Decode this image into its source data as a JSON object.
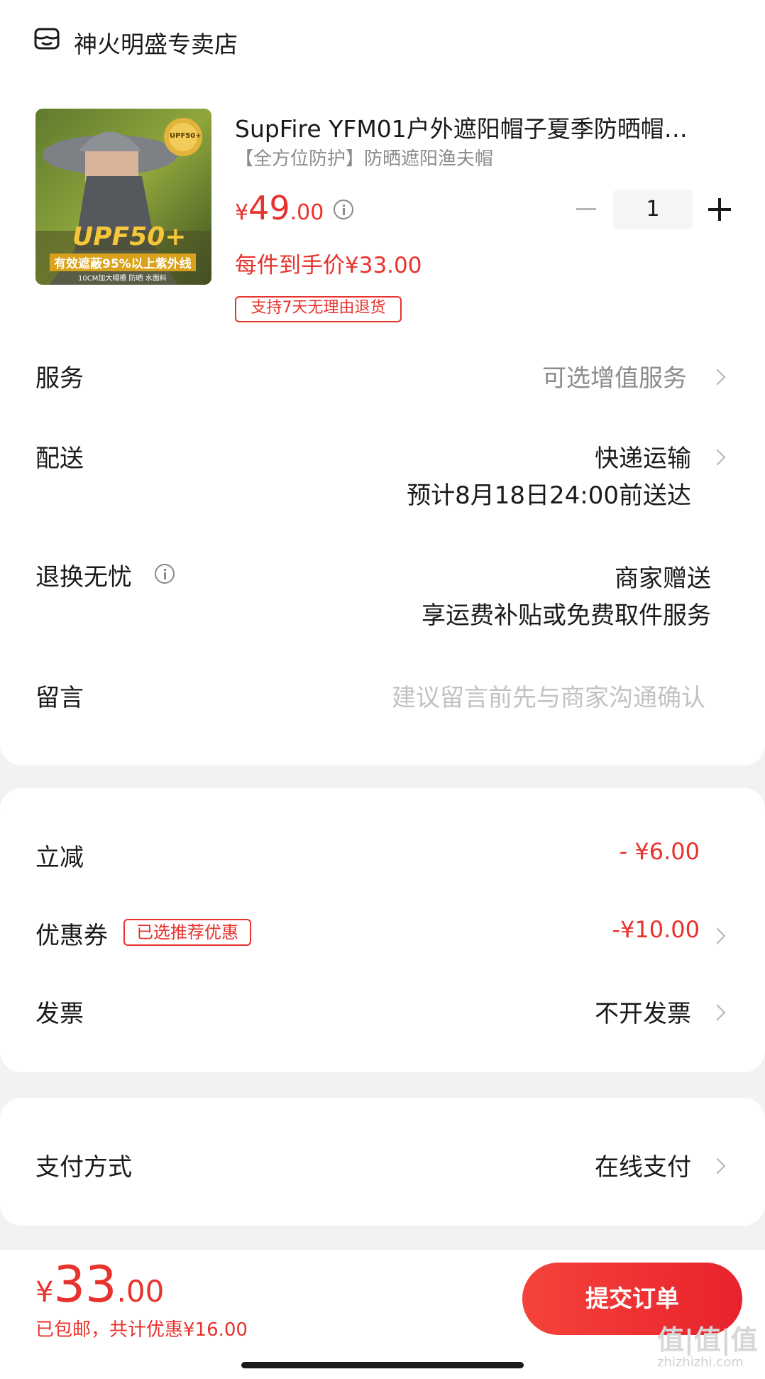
{
  "store": {
    "name": "神火明盛专卖店",
    "icon": "store-icon"
  },
  "product": {
    "title": "SupFire YFM01户外遮阳帽子夏季防晒帽…",
    "subtitle": "【全方位防护】防晒遮阳渔夫帽",
    "price_symbol": "¥",
    "price_int": "49",
    "price_dec": ".00",
    "final_price": "每件到手价¥33.00",
    "return_tag": "支持7天无理由退货",
    "quantity": "1",
    "image_badge": "UPF50+",
    "image_text": "UPF50+",
    "image_banner": "有效遮蔽95%以上紫外线",
    "image_caption": "10CM加大帽檐 防晒 水面料"
  },
  "rows": {
    "service": {
      "label": "服务",
      "value": "可选增值服务"
    },
    "delivery": {
      "label": "配送",
      "value": "快递运输",
      "sub": "预计8月18日24:00前送达"
    },
    "return": {
      "label": "退换无忧",
      "value": "商家赠送",
      "sub": "享运费补贴或免费取件服务"
    },
    "message": {
      "label": "留言",
      "placeholder": "建议留言前先与商家沟通确认"
    }
  },
  "discounts": {
    "instant": {
      "label": "立减",
      "value": "- ¥6.00"
    },
    "coupon": {
      "label": "优惠券",
      "tag": "已选推荐优惠",
      "value": "-¥10.00"
    },
    "invoice": {
      "label": "发票",
      "value": "不开发票"
    }
  },
  "payment": {
    "label": "支付方式",
    "value": "在线支付"
  },
  "footer": {
    "total_symbol": "¥",
    "total_int": "33",
    "total_dec": ".00",
    "summary": "已包邮，共计优惠¥16.00",
    "submit_label": "提交订单",
    "watermark": "值|值|值",
    "watermark_url": "zhizhizhi.com"
  },
  "colors": {
    "accent": "#e8322d",
    "button_start": "#f5433b",
    "button_end": "#e8222d"
  }
}
